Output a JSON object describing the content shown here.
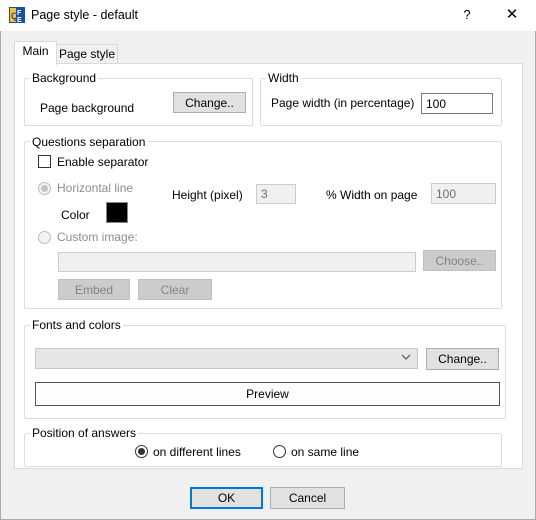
{
  "window": {
    "title": "Page style - default",
    "help": "?",
    "close": "✕"
  },
  "tabs": [
    {
      "label": "Main",
      "active": true
    },
    {
      "label": "Page style",
      "active": false
    }
  ],
  "background": {
    "legend": "Background",
    "label": "Page background",
    "change_button": "Change.."
  },
  "width": {
    "legend": "Width",
    "label": "Page width (in percentage)",
    "value": "100"
  },
  "separation": {
    "legend": "Questions separation",
    "enable_label": "Enable separator",
    "enable_checked": false,
    "horizontal_label": "Horizontal line",
    "color_label": "Color",
    "color_value": "#000000",
    "height_label": "Height (pixel)",
    "height_value": "3",
    "width_label": "% Width on page",
    "width_value": "100",
    "custom_label": "Custom image:",
    "image_path": "",
    "choose_button": "Choose..",
    "embed_button": "Embed",
    "clear_button": "Clear"
  },
  "fonts": {
    "legend": "Fonts and colors",
    "selected": "",
    "change_button": "Change..",
    "preview_button": "Preview"
  },
  "position": {
    "legend": "Position of answers",
    "option_different": "on different lines",
    "option_same": "on same line",
    "selected": "different"
  },
  "footer": {
    "ok": "OK",
    "cancel": "Cancel"
  }
}
